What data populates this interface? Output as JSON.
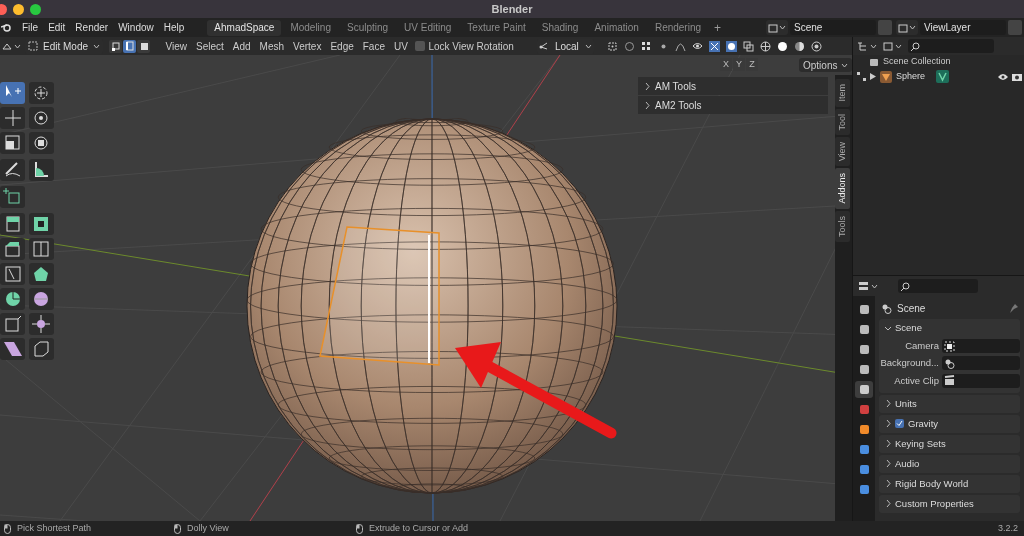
{
  "window": {
    "title": "Blender"
  },
  "menu": [
    "File",
    "Edit",
    "Render",
    "Window",
    "Help"
  ],
  "workspace_tabs": [
    {
      "label": "AhmadSpace",
      "selected": true
    },
    {
      "label": "Modeling",
      "selected": false
    },
    {
      "label": "Sculpting",
      "selected": false
    },
    {
      "label": "UV Editing",
      "selected": false
    },
    {
      "label": "Texture Paint",
      "selected": false
    },
    {
      "label": "Shading",
      "selected": false
    },
    {
      "label": "Animation",
      "selected": false
    },
    {
      "label": "Rendering",
      "selected": false
    }
  ],
  "add_workspace": "+",
  "scene": {
    "value": "Scene"
  },
  "view_layer": {
    "value": "ViewLayer"
  },
  "header": {
    "mode": "Edit Mode",
    "select_modes": [
      {
        "kind": "vertex",
        "selected": false
      },
      {
        "kind": "edge",
        "selected": true
      },
      {
        "kind": "face",
        "selected": false
      }
    ],
    "menus": [
      "View",
      "Select",
      "Add",
      "Mesh",
      "Vertex",
      "Edge",
      "Face",
      "UV"
    ],
    "lock_view_rotation": {
      "label": "Lock View Rotation",
      "checked": false
    },
    "orientation": "Local",
    "axes": [
      "X",
      "Y",
      "Z"
    ],
    "options": "Options"
  },
  "tool_groups": [
    [
      {
        "kind": "select",
        "selected": true
      },
      {
        "kind": "cursor",
        "selected": false
      },
      {
        "kind": "move",
        "selected": false
      },
      {
        "kind": "rotate",
        "selected": false
      },
      {
        "kind": "scale",
        "selected": false
      },
      {
        "kind": "transform",
        "selected": false
      }
    ],
    [
      {
        "kind": "annotate",
        "selected": false
      },
      {
        "kind": "measure",
        "selected": false
      }
    ],
    [
      {
        "kind": "add-cube",
        "selected": false
      }
    ],
    [
      {
        "kind": "extrude",
        "selected": false
      },
      {
        "kind": "inset",
        "selected": false
      },
      {
        "kind": "bevel",
        "selected": false
      },
      {
        "kind": "loop-cut",
        "selected": false
      },
      {
        "kind": "knife",
        "selected": false
      },
      {
        "kind": "poly-build",
        "selected": false
      },
      {
        "kind": "spin",
        "selected": false
      },
      {
        "kind": "smooth",
        "selected": false
      },
      {
        "kind": "edge-slide",
        "selected": false
      },
      {
        "kind": "shrink",
        "selected": false
      },
      {
        "kind": "shear",
        "selected": false
      },
      {
        "kind": "rip",
        "selected": false
      }
    ]
  ],
  "sidebar_panels": [
    {
      "label": "AM Tools",
      "expanded": false
    },
    {
      "label": "AM2 Tools",
      "expanded": false
    }
  ],
  "sidebar_tabs": [
    {
      "label": "Item",
      "selected": false
    },
    {
      "label": "Tool",
      "selected": false
    },
    {
      "label": "View",
      "selected": false
    },
    {
      "label": "Addons",
      "selected": true
    },
    {
      "label": "Tools",
      "selected": false
    }
  ],
  "outliner": {
    "root": "Scene Collection",
    "children": [
      {
        "label": "Sphere",
        "expanded": false
      }
    ]
  },
  "properties": {
    "title": "Scene",
    "tabs": [
      {
        "kind": "tool",
        "selected": false
      },
      {
        "kind": "render",
        "selected": false
      },
      {
        "kind": "output",
        "selected": false
      },
      {
        "kind": "view-layer",
        "selected": false
      },
      {
        "kind": "scene",
        "selected": true
      },
      {
        "kind": "world",
        "selected": false
      },
      {
        "kind": "object",
        "selected": false
      },
      {
        "kind": "modifier",
        "selected": false
      },
      {
        "kind": "particles",
        "selected": false
      },
      {
        "kind": "physics",
        "selected": false
      }
    ],
    "panels": [
      {
        "label": "Scene",
        "expanded": true,
        "fields": [
          {
            "label": "Camera",
            "kind": "camera"
          },
          {
            "label": "Background...",
            "kind": "scene"
          },
          {
            "label": "Active Clip",
            "kind": "clip"
          }
        ]
      },
      {
        "label": "Units",
        "expanded": false
      },
      {
        "label": "Gravity",
        "expanded": false,
        "checked": true
      },
      {
        "label": "Keying Sets",
        "expanded": false
      },
      {
        "label": "Audio",
        "expanded": false
      },
      {
        "label": "Rigid Body World",
        "expanded": false
      },
      {
        "label": "Custom Properties",
        "expanded": false
      }
    ]
  },
  "status_bar": {
    "hints": [
      "Pick Shortest Path",
      "Dolly View",
      "Extrude to Cursor or Add"
    ],
    "version": "3.2.2"
  }
}
